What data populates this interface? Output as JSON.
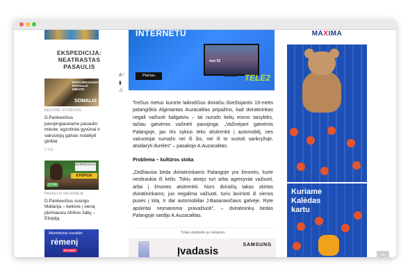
{
  "left": {
    "section_title": "EKSPEDICIJA: NEATRASTAS PASAULIS",
    "card1": {
      "overlay": "PAVOJINGIAUSIAME PASAULIO MIESTE:",
      "big": "SOMALIS",
      "category": "KELIONĖ ISTORIJOS",
      "title": "D.Pankevičius pavojingiausiame pasaulio mieste: egzotiniai gyvūnai ir vairuotojų galvas nutaikyti ginklai",
      "meta": "2  163"
    },
    "card2": {
      "logo": "EKSPEDICIJA",
      "stripe": "ETIOPIJA",
      "pill": "12:04",
      "category": "PASAULIS KELIONĖJE",
      "title": "D.Pankevičius susirgo Maliarija – kelionė į vieną įdomiausiu Afrikos šalių – Etiopiją"
    },
    "ad": {
      "line1": "Akimirksniu suvaldo",
      "line2": "rėmenį",
      "badge": "PLAMIŠ"
    }
  },
  "tools": [
    "A⁺",
    "▮",
    "⚠"
  ],
  "center": {
    "ad": {
      "headline": "INTERNETU",
      "button": "Plačiau",
      "brand": "TELE2",
      "price": "nuo 32"
    },
    "paragraphs": [
      "Trečius metus kurorte laikraščius dviračiu išvežiojantis 19-metis palangiškis Algimantas Auzacalitas pripažino, kad dviratininkas negali važiuoti šaligatviu – tai nurodo kelių eismo taisyklės, tačiau gatvėmis važinėti pavojinga. „Važinėjant gatvėmis Palangoje, jau tris sykius teko atsitrenkti į automobilį, nes vairuotojai sumažo nei iš šio, nei iš to sustoti sankryžoje, atsidaryti dureles\" – pasakojo A.Auzacalitas."
    ],
    "subheading": "Problema – kultūros stoka",
    "paragraphs2": [
      "„Didžiausia bėda dviratininkams Palangoje yra žmonės, kurie nesitraukia iš kelio. Tokiu atveju turi arba agresyviai važiuoti, arba į žmones atsitrenkti. Nors dviračių takas skirtas dviratininkams, juo negalima važiuoti, turiu lavirūoti iš vienos pusės į kitą. Ir dar automobiliai J.Basanavičiaus gatvėje. Ryte apskritai neįmanoma pravažiuoti\", – dviratininkų bėdas Palangoje vardijo A.Auzacalitas."
    ],
    "ad_label": "Toliau skaitykite po reklamos",
    "samsung": {
      "text": "Įvadasis",
      "brand": "SAMSUNG"
    }
  },
  "right": {
    "logo_main": "MA",
    "logo_x": "X",
    "logo_end": "IMA",
    "ad2_headline": "Kuriame Kalėdas kartu"
  },
  "scroll_top": "⌃"
}
